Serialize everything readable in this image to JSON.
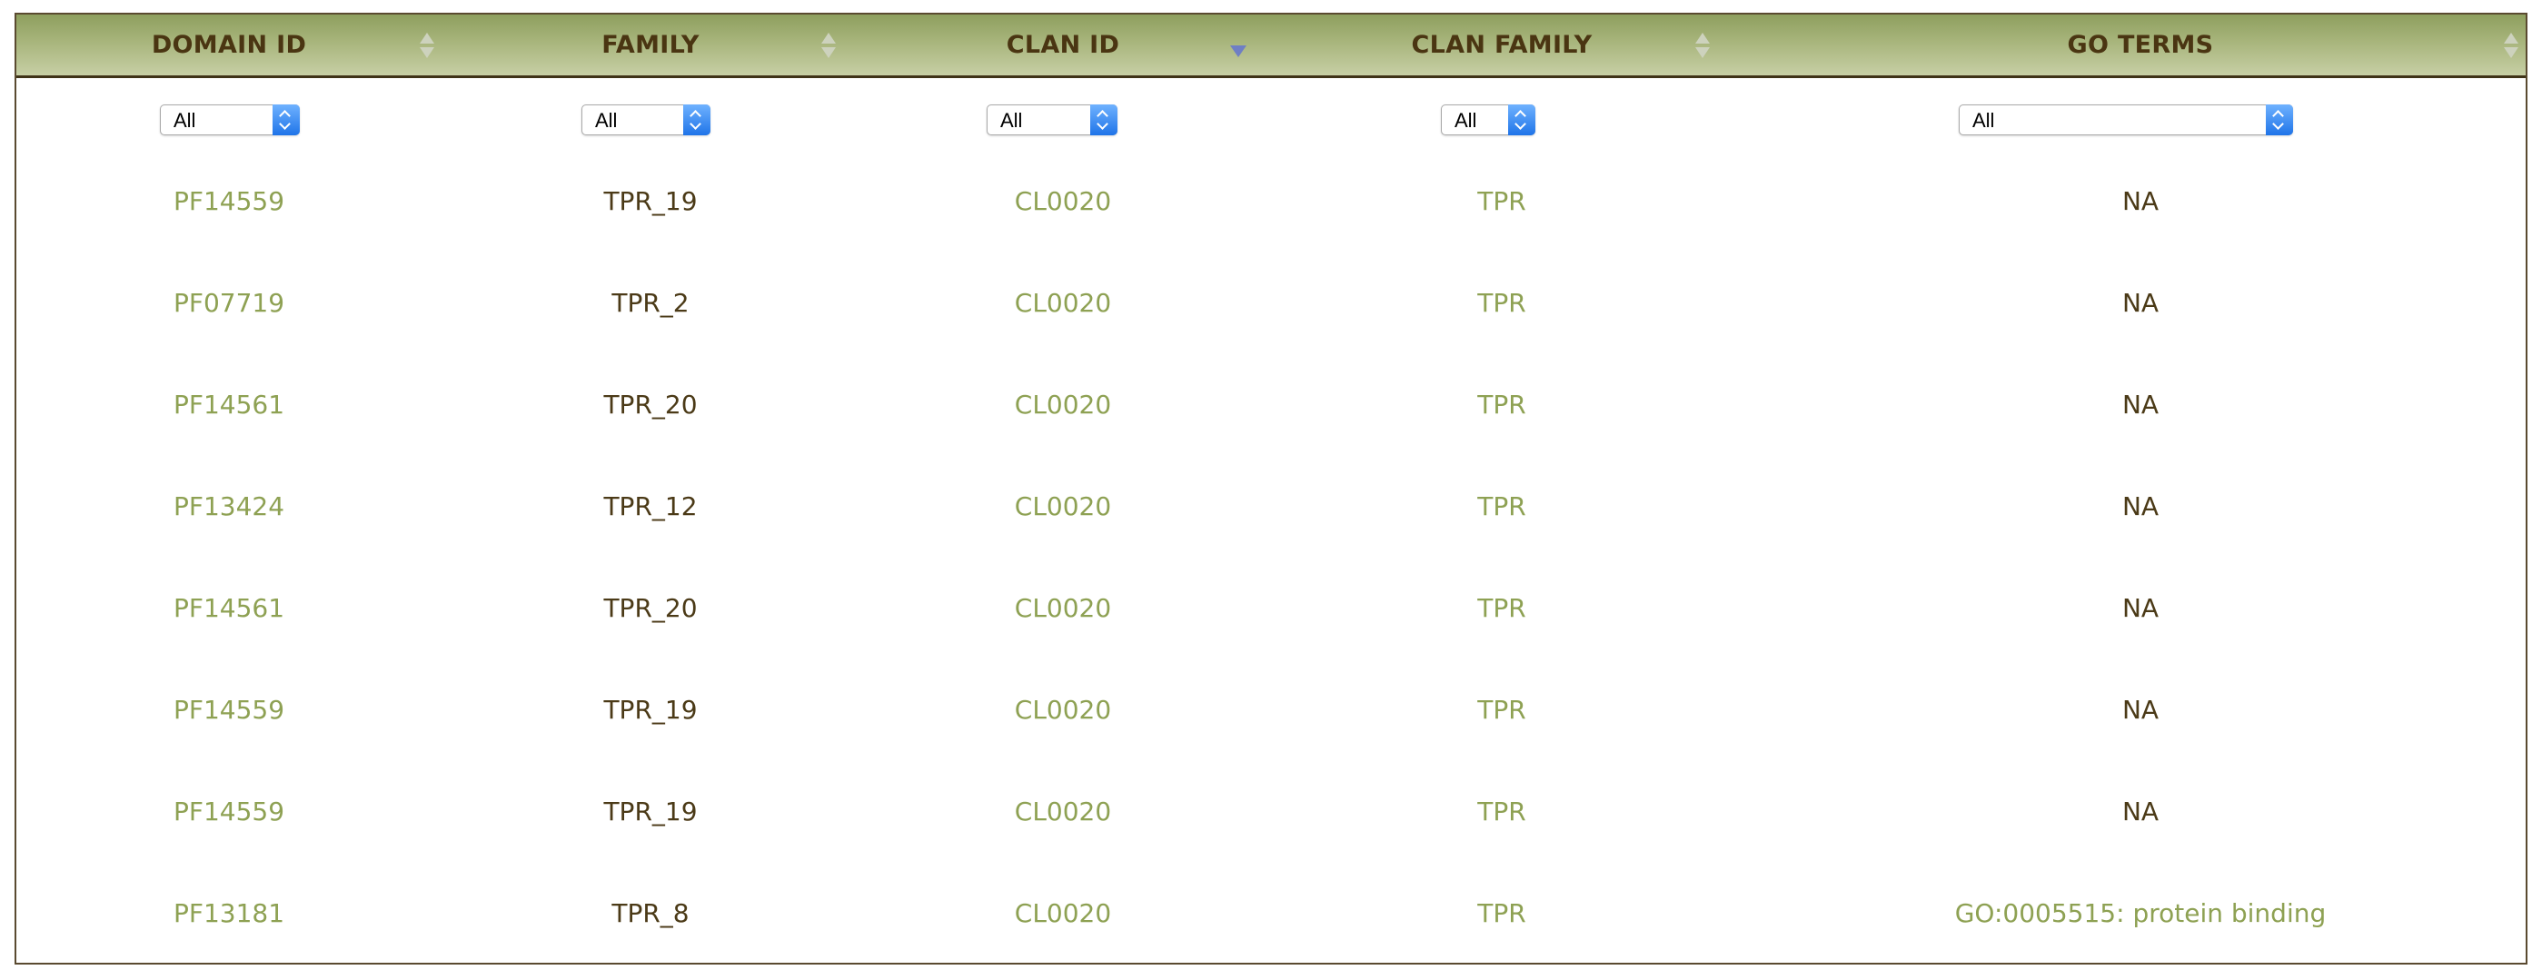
{
  "table": {
    "headers": [
      {
        "label": "DOMAIN ID"
      },
      {
        "label": "FAMILY"
      },
      {
        "label": "CLAN ID"
      },
      {
        "label": "CLAN FAMILY"
      },
      {
        "label": "GO TERMS"
      }
    ],
    "sorted_column": "CLAN ID",
    "sort_direction": "descending",
    "filters": [
      "All",
      "All",
      "All",
      "All",
      "All"
    ],
    "rows": [
      {
        "domain_id": "PF14559",
        "family": "TPR_19",
        "clan_id": "CL0020",
        "clan_family": "TPR",
        "go_terms": "NA"
      },
      {
        "domain_id": "PF07719",
        "family": "TPR_2",
        "clan_id": "CL0020",
        "clan_family": "TPR",
        "go_terms": "NA"
      },
      {
        "domain_id": "PF14561",
        "family": "TPR_20",
        "clan_id": "CL0020",
        "clan_family": "TPR",
        "go_terms": "NA"
      },
      {
        "domain_id": "PF13424",
        "family": "TPR_12",
        "clan_id": "CL0020",
        "clan_family": "TPR",
        "go_terms": "NA"
      },
      {
        "domain_id": "PF14561",
        "family": "TPR_20",
        "clan_id": "CL0020",
        "clan_family": "TPR",
        "go_terms": "NA"
      },
      {
        "domain_id": "PF14559",
        "family": "TPR_19",
        "clan_id": "CL0020",
        "clan_family": "TPR",
        "go_terms": "NA"
      },
      {
        "domain_id": "PF14559",
        "family": "TPR_19",
        "clan_id": "CL0020",
        "clan_family": "TPR",
        "go_terms": "NA"
      },
      {
        "domain_id": "PF13181",
        "family": "TPR_8",
        "clan_id": "CL0020",
        "clan_family": "TPR",
        "go_terms": "GO:0005515: protein binding"
      }
    ]
  },
  "colors": {
    "header_gradient_top": "#8e9f5e",
    "header_text": "#4a3512",
    "link_text": "#8ea153",
    "body_text": "#4b3a17",
    "active_sort_arrow": "#6f7fc4"
  }
}
